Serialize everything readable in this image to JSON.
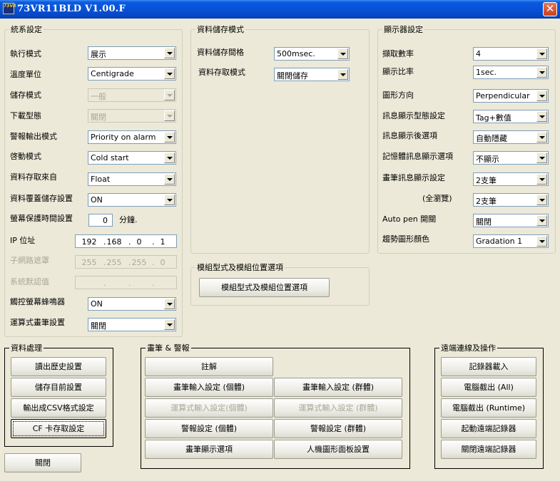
{
  "window": {
    "title": "73VR11BLD V1.00.F",
    "icon_text": "73VR"
  },
  "system": {
    "legend": "統系設定",
    "exec_mode": {
      "label": "執行模式",
      "value": "展示"
    },
    "temp_unit": {
      "label": "溫度單位",
      "value": "Centigrade"
    },
    "storage_mode": {
      "label": "儲存模式",
      "value": "一般"
    },
    "download_type": {
      "label": "下載型態",
      "value": "關閉"
    },
    "alarm_output": {
      "label": "警報輸出模式",
      "value": "Priority on alarm"
    },
    "start_mode": {
      "label": "啓動模式",
      "value": "Cold start"
    },
    "data_source": {
      "label": "資料存取來自",
      "value": "Float"
    },
    "data_overwrite": {
      "label": "資料覆蓋儲存設置",
      "value": "ON"
    },
    "screensaver": {
      "label": "螢幕保護時間設置",
      "value": "0",
      "unit": "分鐘."
    },
    "ip": {
      "label": "IP 位址",
      "octets": [
        "192",
        "168",
        "0",
        "1"
      ]
    },
    "subnet": {
      "label": "子網路遮罩",
      "octets": [
        "255",
        "255",
        "255",
        "0"
      ]
    },
    "gateway": {
      "label": "系統默認值",
      "octets": [
        "",
        "",
        "",
        ""
      ]
    },
    "touch_buzzer": {
      "label": "觸控螢幕蜂鳴器",
      "value": "ON"
    },
    "math_pen": {
      "label": "運算式畫筆設置",
      "value": "關閉"
    }
  },
  "storage": {
    "legend": "資料儲存模式",
    "interval": {
      "label": "資料儲存間格",
      "value": "500msec."
    },
    "access_mode": {
      "label": "資料存取模式",
      "value": "關閉儲存"
    }
  },
  "module": {
    "legend": "模組型式及模組位置選項",
    "button": "模組型式及模組位置選項"
  },
  "display": {
    "legend": "顯示器設定",
    "sample_count": {
      "label": "擷取數率",
      "value": "4"
    },
    "display_ratio": {
      "label": "顯示比率",
      "value": "1sec."
    },
    "graph_direction": {
      "label": "圖形方向",
      "value": "Perpendicular"
    },
    "msg_type": {
      "label": "訊息顯示型態設定",
      "value": "Tag+數值"
    },
    "msg_after": {
      "label": "訊息顯示後選項",
      "value": "自動隱藏"
    },
    "memory_msg": {
      "label": "記憶體訊息顯示選項",
      "value": "不顯示"
    },
    "pen_msg": {
      "label": "畫筆訊息顯示設定",
      "value": "2支筆"
    },
    "full_view": {
      "label": "(全瀏覽)",
      "value": "2支筆"
    },
    "auto_pen": {
      "label": "Auto pen 開關",
      "value": "關閉"
    },
    "trend_color": {
      "label": "趨勢圖形顏色",
      "value": "Gradation 1"
    }
  },
  "data_proc": {
    "legend": "資料處理",
    "buttons": [
      "讀出歷史設置",
      "儲存目前設置",
      "輸出成CSV格式設定",
      "CF 卡存取設定"
    ]
  },
  "pen_alarm": {
    "legend": "畫筆 & 警報",
    "note": "註解",
    "pen_input_single": "畫筆輸入設定 (個體)",
    "pen_input_group": "畫筆輸入設定 (群體)",
    "math_input_single": "運算式輸入設定(個體)",
    "math_input_group": "運算式輸入設定 (群體)",
    "alarm_single": "警報設定 (個體)",
    "alarm_group": "警報設定 (群體)",
    "pen_display": "畫筆顯示選項",
    "hmi_panel": "人機圖形面板設置"
  },
  "remote": {
    "legend": "遠端連線及操作",
    "buttons": [
      "記錄器載入",
      "電腦截出 (All)",
      "電腦截出 (Runtime)",
      "起動遠端記錄器",
      "關閉遠端記錄器"
    ]
  },
  "close_button": "關閉"
}
